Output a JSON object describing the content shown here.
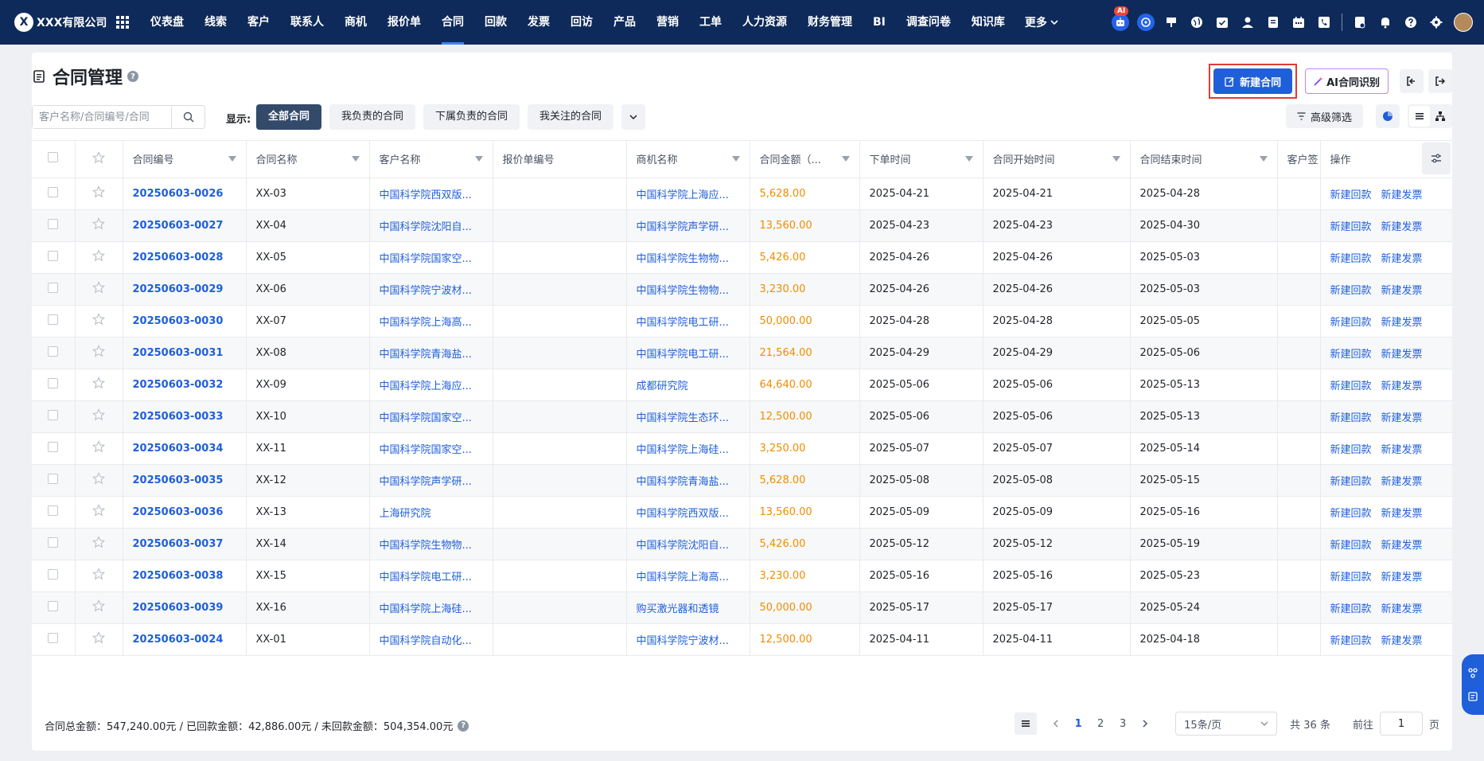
{
  "app": {
    "company": "XXX有限公司",
    "logo_char": "X"
  },
  "nav": {
    "items": [
      "仪表盘",
      "线索",
      "客户",
      "联系人",
      "商机",
      "报价单",
      "合同",
      "回款",
      "发票",
      "回访",
      "产品",
      "营销",
      "工单",
      "人力资源",
      "财务管理",
      "BI",
      "调查问卷",
      "知识库"
    ],
    "active": "合同",
    "more_label": "更多",
    "ai_badge": "AI"
  },
  "page": {
    "title": "合同管理",
    "help_char": "?"
  },
  "actions": {
    "new_contract": "新建合同",
    "ai_recognize": "AI合同识别"
  },
  "filters": {
    "search_placeholder": "客户名称/合同编号/合同",
    "show_label": "显示:",
    "tabs": [
      "全部合同",
      "我负责的合同",
      "下属负责的合同",
      "我关注的合同"
    ],
    "active_tab": 0,
    "advanced": "高级筛选"
  },
  "table": {
    "columns": [
      "合同编号",
      "合同名称",
      "客户名称",
      "报价单编号",
      "商机名称",
      "合同金额（...",
      "下单时间",
      "合同开始时间",
      "合同结束时间",
      "客户签",
      "操作"
    ],
    "op_labels": [
      "新建回款",
      "新建发票"
    ],
    "rows": [
      {
        "no": "20250603-0026",
        "name": "XX-03",
        "customer": "中国科学院西双版...",
        "quote": "",
        "opp": "中国科学院上海应...",
        "amount": "5,628.00",
        "order": "2025-04-21",
        "start": "2025-04-21",
        "end": "2025-04-28"
      },
      {
        "no": "20250603-0027",
        "name": "XX-04",
        "customer": "中国科学院沈阳自...",
        "quote": "",
        "opp": "中国科学院声学研...",
        "amount": "13,560.00",
        "order": "2025-04-23",
        "start": "2025-04-23",
        "end": "2025-04-30"
      },
      {
        "no": "20250603-0028",
        "name": "XX-05",
        "customer": "中国科学院国家空...",
        "quote": "",
        "opp": "中国科学院生物物...",
        "amount": "5,426.00",
        "order": "2025-04-26",
        "start": "2025-04-26",
        "end": "2025-05-03"
      },
      {
        "no": "20250603-0029",
        "name": "XX-06",
        "customer": "中国科学院宁波材...",
        "quote": "",
        "opp": "中国科学院生物物...",
        "amount": "3,230.00",
        "order": "2025-04-26",
        "start": "2025-04-26",
        "end": "2025-05-03"
      },
      {
        "no": "20250603-0030",
        "name": "XX-07",
        "customer": "中国科学院上海高...",
        "quote": "",
        "opp": "中国科学院电工研...",
        "amount": "50,000.00",
        "order": "2025-04-28",
        "start": "2025-04-28",
        "end": "2025-05-05"
      },
      {
        "no": "20250603-0031",
        "name": "XX-08",
        "customer": "中国科学院青海盐...",
        "quote": "",
        "opp": "中国科学院电工研...",
        "amount": "21,564.00",
        "order": "2025-04-29",
        "start": "2025-04-29",
        "end": "2025-05-06"
      },
      {
        "no": "20250603-0032",
        "name": "XX-09",
        "customer": "中国科学院上海应...",
        "quote": "",
        "opp": "成都研究院",
        "amount": "64,640.00",
        "order": "2025-05-06",
        "start": "2025-05-06",
        "end": "2025-05-13"
      },
      {
        "no": "20250603-0033",
        "name": "XX-10",
        "customer": "中国科学院国家空...",
        "quote": "",
        "opp": "中国科学院生态环...",
        "amount": "12,500.00",
        "order": "2025-05-06",
        "start": "2025-05-06",
        "end": "2025-05-13"
      },
      {
        "no": "20250603-0034",
        "name": "XX-11",
        "customer": "中国科学院国家空...",
        "quote": "",
        "opp": "中国科学院上海硅...",
        "amount": "3,250.00",
        "order": "2025-05-07",
        "start": "2025-05-07",
        "end": "2025-05-14"
      },
      {
        "no": "20250603-0035",
        "name": "XX-12",
        "customer": "中国科学院声学研...",
        "quote": "",
        "opp": "中国科学院青海盐...",
        "amount": "5,628.00",
        "order": "2025-05-08",
        "start": "2025-05-08",
        "end": "2025-05-15"
      },
      {
        "no": "20250603-0036",
        "name": "XX-13",
        "customer": "上海研究院",
        "quote": "",
        "opp": "中国科学院西双版...",
        "amount": "13,560.00",
        "order": "2025-05-09",
        "start": "2025-05-09",
        "end": "2025-05-16"
      },
      {
        "no": "20250603-0037",
        "name": "XX-14",
        "customer": "中国科学院生物物...",
        "quote": "",
        "opp": "中国科学院沈阳自...",
        "amount": "5,426.00",
        "order": "2025-05-12",
        "start": "2025-05-12",
        "end": "2025-05-19"
      },
      {
        "no": "20250603-0038",
        "name": "XX-15",
        "customer": "中国科学院电工研...",
        "quote": "",
        "opp": "中国科学院上海高...",
        "amount": "3,230.00",
        "order": "2025-05-16",
        "start": "2025-05-16",
        "end": "2025-05-23"
      },
      {
        "no": "20250603-0039",
        "name": "XX-16",
        "customer": "中国科学院上海硅...",
        "quote": "",
        "opp": "购买激光器和透镜",
        "amount": "50,000.00",
        "order": "2025-05-17",
        "start": "2025-05-17",
        "end": "2025-05-24"
      },
      {
        "no": "20250603-0024",
        "name": "XX-01",
        "customer": "中国科学院自动化...",
        "quote": "",
        "opp": "中国科学院宁波材...",
        "amount": "12,500.00",
        "order": "2025-04-11",
        "start": "2025-04-11",
        "end": "2025-04-18"
      }
    ]
  },
  "summary": {
    "text": "合同总金额：547,240.00元 / 已回款金额：42,886.00元 / 未回款金额：504,354.00元"
  },
  "pagination": {
    "pages": [
      "1",
      "2",
      "3"
    ],
    "current": "1",
    "page_size": "15条/页",
    "total": "共 36 条",
    "goto_label": "前往",
    "goto_value": "1",
    "page_unit": "页"
  },
  "colors": {
    "nav_bg": "#0e2a5a",
    "primary": "#1f5fd9",
    "amount": "#f08c00",
    "highlight": "#e53935"
  }
}
